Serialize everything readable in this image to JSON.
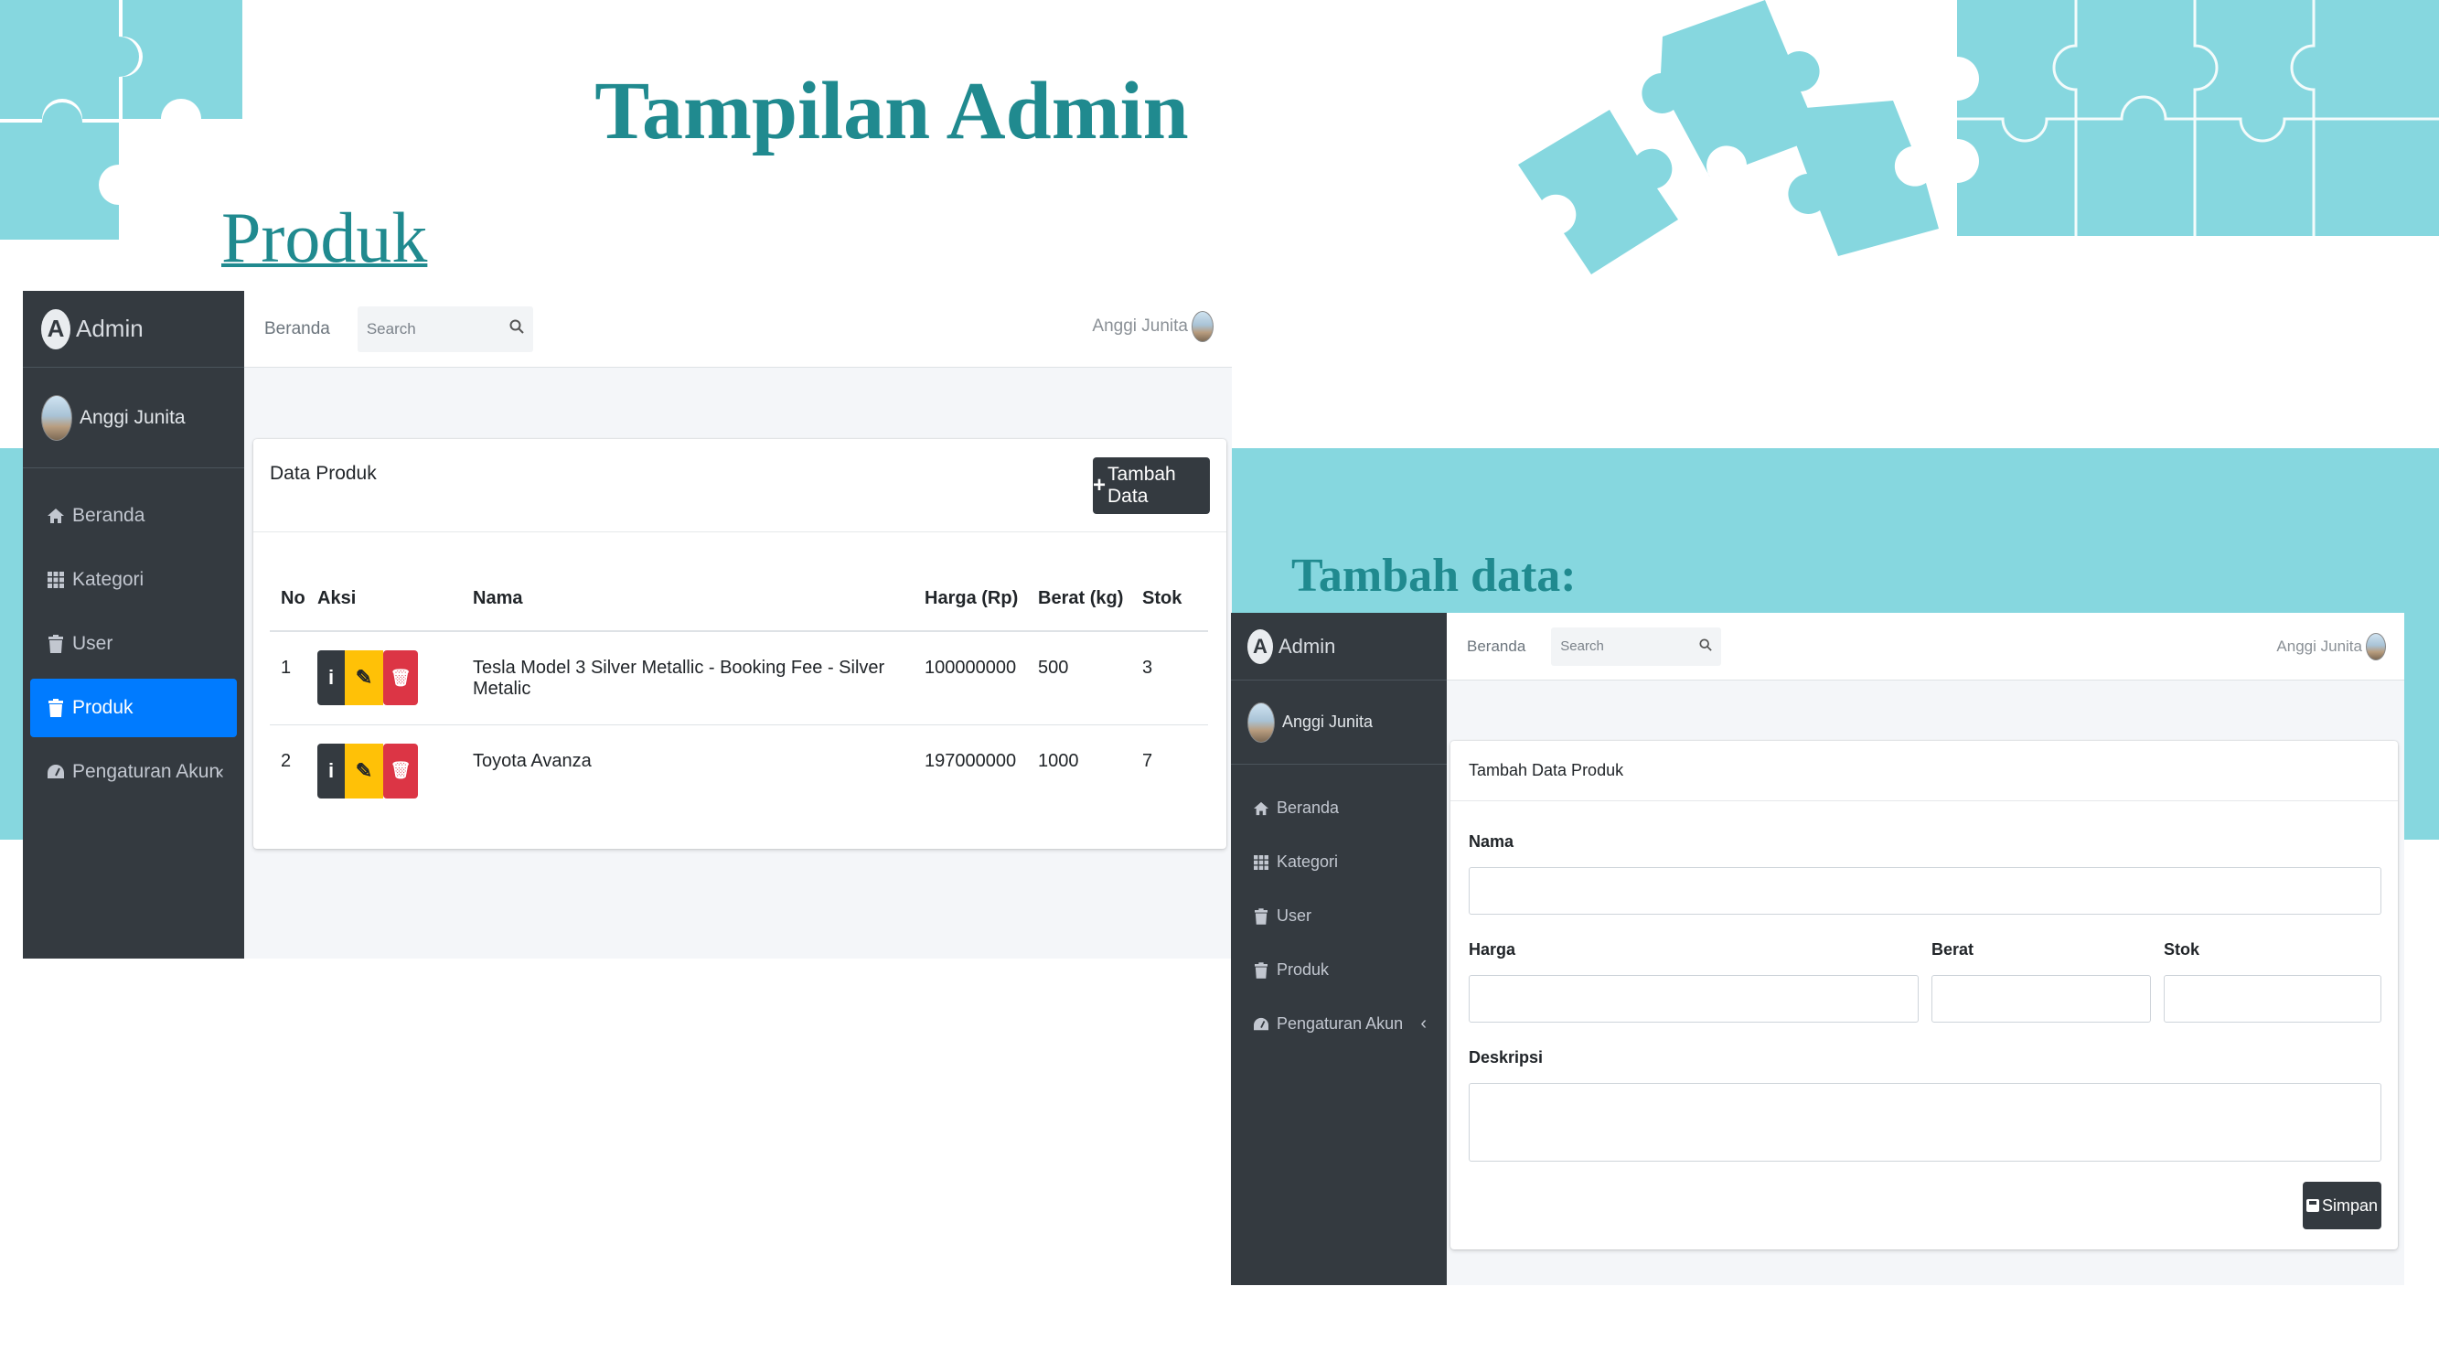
{
  "slide": {
    "title": "Tampilan Admin",
    "section": "Produk",
    "subsection": "Tambah data:"
  },
  "colors": {
    "teal": "#86d7df",
    "title": "#208a8f",
    "sidebar": "#343a40",
    "primary": "#007bff",
    "warning": "#ffc107",
    "danger": "#dc3545"
  },
  "admin": {
    "brand": "Admin",
    "brand_logo": "A",
    "user_name": "Anggi Junita",
    "nav": [
      {
        "label": "Beranda",
        "icon": "home-icon"
      },
      {
        "label": "Kategori",
        "icon": "grid-icon"
      },
      {
        "label": "User",
        "icon": "trash-icon"
      },
      {
        "label": "Produk",
        "icon": "trash-icon"
      },
      {
        "label": "Pengaturan Akun",
        "icon": "dashboard-icon"
      }
    ],
    "topbar": {
      "home": "Beranda",
      "search_placeholder": "Search",
      "user": "Anggi Junita"
    }
  },
  "produk_screen": {
    "active_nav": "Produk",
    "card_title": "Data Produk",
    "add_button": "Tambah Data",
    "columns": [
      "No",
      "Aksi",
      "Nama",
      "Harga (Rp)",
      "Berat (kg)",
      "Stok"
    ],
    "rows": [
      {
        "no": "1",
        "nama": "Tesla Model 3 Silver Metallic - Booking Fee - Silver Metalic",
        "harga": "100000000",
        "berat": "500",
        "stok": "3"
      },
      {
        "no": "2",
        "nama": "Toyota Avanza",
        "harga": "197000000",
        "berat": "1000",
        "stok": "7"
      }
    ],
    "action_icons": {
      "info": "i",
      "edit": "✎",
      "delete": "🗑"
    }
  },
  "form_screen": {
    "card_title": "Tambah Data Produk",
    "labels": {
      "nama": "Nama",
      "harga": "Harga",
      "berat": "Berat",
      "stok": "Stok",
      "deskripsi": "Deskripsi"
    },
    "save_button": "Simpan"
  }
}
